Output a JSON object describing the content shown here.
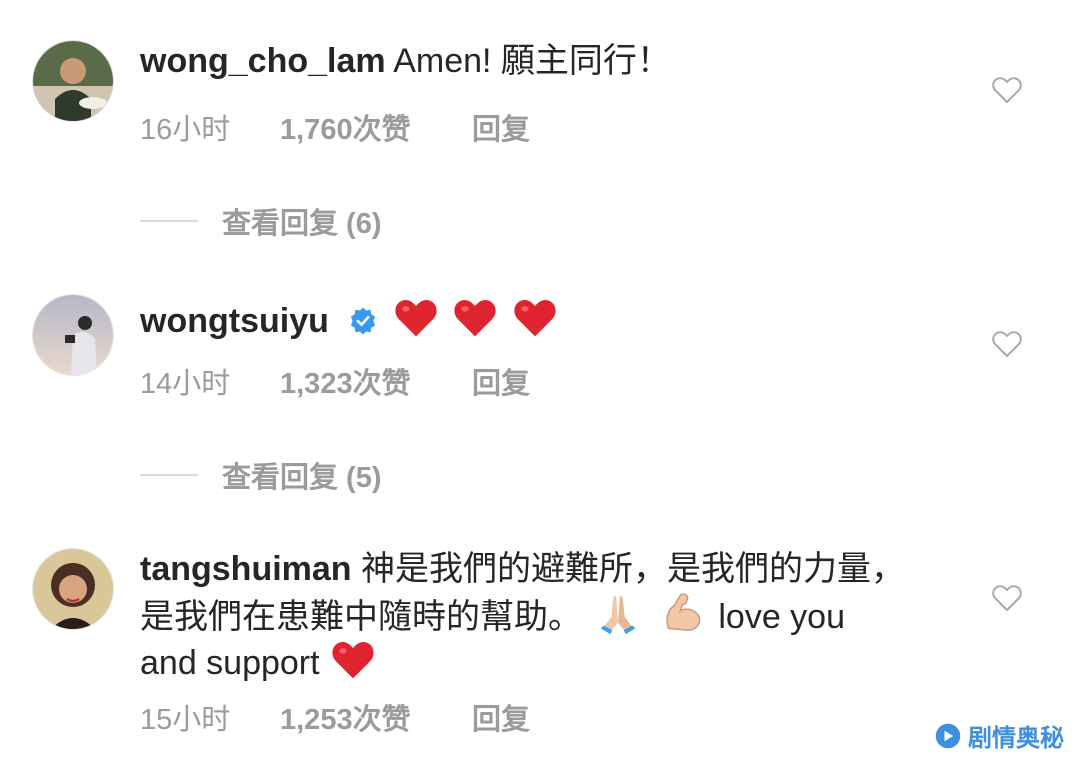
{
  "comments": [
    {
      "username": "wong_cho_lam",
      "text": "Amen! 願主同行！",
      "time": "16小时",
      "likes": "1,760次赞",
      "reply": "回复",
      "view_replies": "查看回复 (6)"
    },
    {
      "username": "wongtsuiyu",
      "verified": true,
      "emojis": [
        "heart-emoji",
        "heart-emoji",
        "heart-emoji"
      ],
      "time": "14小时",
      "likes": "1,323次赞",
      "reply": "回复",
      "view_replies": "查看回复 (5)"
    },
    {
      "username": "tangshuiman",
      "text_part1": "神是我們的避難所，是我們的力量，是我們在患難中隨時的幫助。",
      "emojis": [
        "praying-hands-emoji",
        "flexed-biceps-emoji"
      ],
      "text_part2": "love you and support",
      "end_emoji": "heart-emoji",
      "time": "15小时",
      "likes": "1,253次赞",
      "reply": "回复"
    }
  ],
  "watermark": "剧情奥秘",
  "colors": {
    "primary_text": "#262626",
    "secondary_text": "#9b9b9b",
    "verified_blue": "#3897f0",
    "heart_red": "#e0242f",
    "watermark_blue": "#3d8fe0"
  }
}
